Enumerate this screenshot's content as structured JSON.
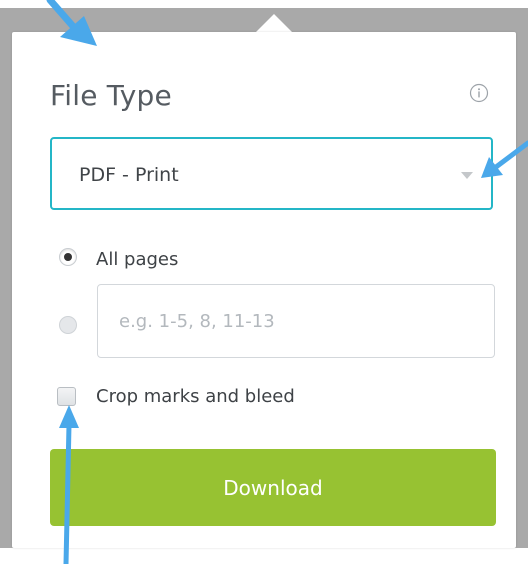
{
  "panel": {
    "title": "File Type",
    "info_icon": "info-circle-icon",
    "file_type_select": {
      "selected": "PDF - Print",
      "icon": "chevron-down-icon"
    },
    "page_options": {
      "all_pages_label": "All pages",
      "all_pages_selected": true,
      "range_placeholder": "e.g. 1-5, 8, 11-13",
      "range_value": ""
    },
    "crop_marks": {
      "label": "Crop marks and bleed",
      "checked": false
    },
    "download_label": "Download"
  },
  "colors": {
    "accent_border": "#24b6c7",
    "download_button": "#97c232",
    "annotation_arrow": "#4aa8ea",
    "backdrop": "#a9a9a9"
  }
}
